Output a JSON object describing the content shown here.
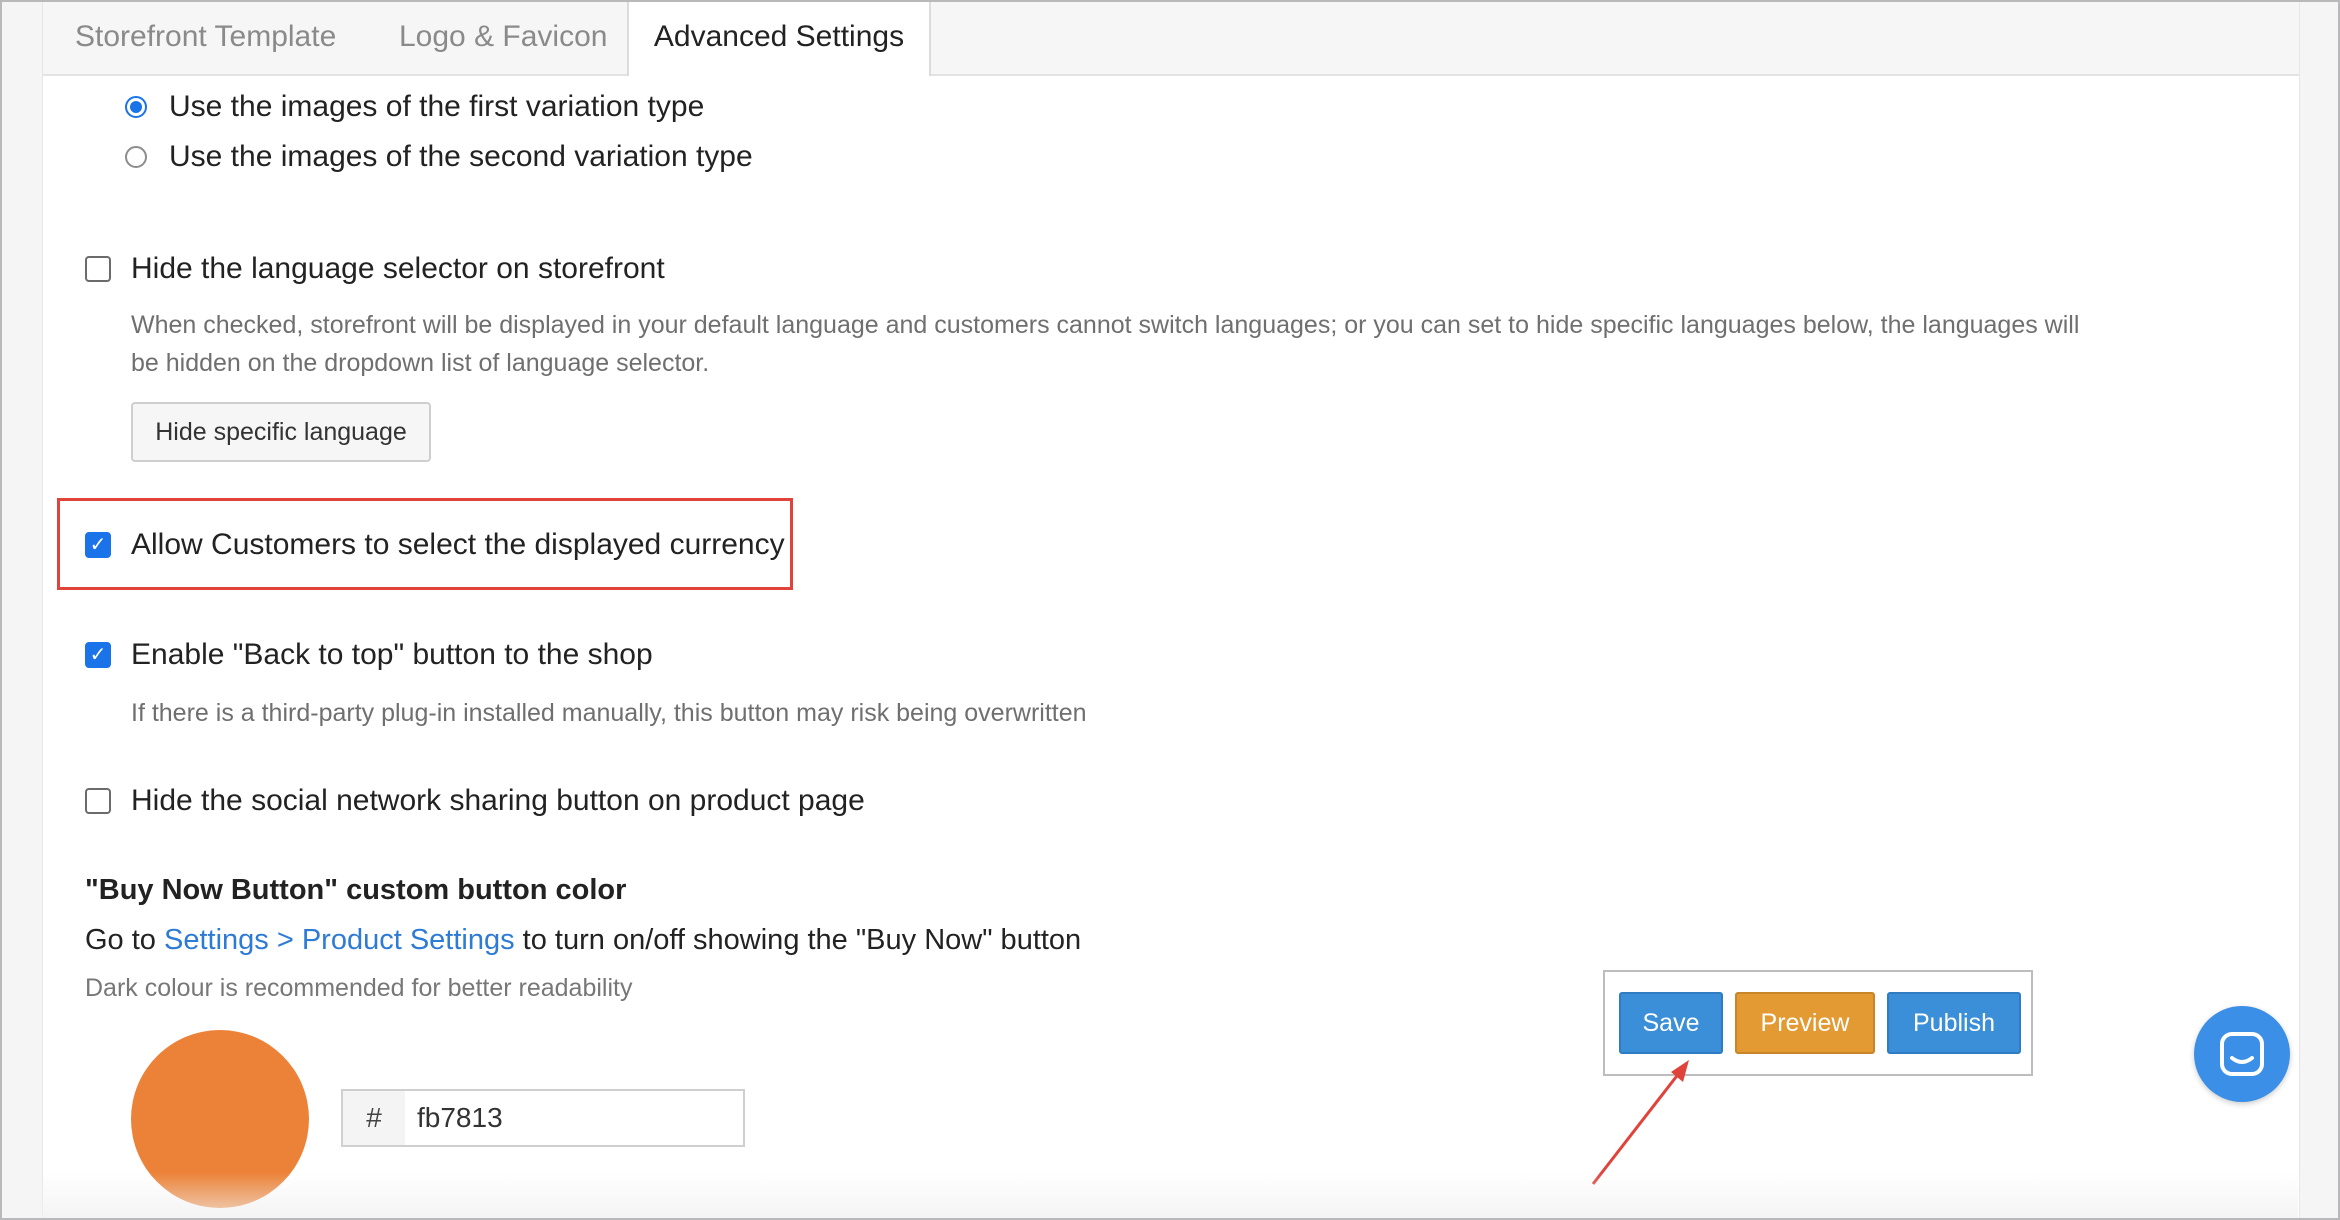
{
  "tabs": [
    {
      "label": "Storefront Template"
    },
    {
      "label": "Logo & Favicon"
    },
    {
      "label": "Advanced Settings"
    }
  ],
  "variation": {
    "option1": "Use the images of the first variation type",
    "option2": "Use the images of the second variation type"
  },
  "language": {
    "label": "Hide the language selector on storefront",
    "help_line1": "When checked, storefront will be displayed in your default language and customers cannot switch languages; or you can set to hide specific languages below, the languages will",
    "help_line2": "be hidden on the dropdown list of language selector.",
    "button": "Hide specific language"
  },
  "currency": {
    "label": "Allow Customers to select the displayed currency"
  },
  "back_to_top": {
    "label": "Enable \"Back to top\" button to the shop",
    "help": "If there is a third-party plug-in installed manually, this button may risk being overwritten"
  },
  "social": {
    "label": "Hide the social network sharing button on product page"
  },
  "buy_now": {
    "title": "\"Buy Now Button\" custom button color",
    "goto_prefix": "Go to ",
    "goto_link": "Settings > Product Settings",
    "goto_suffix": " to turn on/off showing the \"Buy Now\" button",
    "note": "Dark colour is recommended for better readability",
    "hash": "#",
    "hex_value": "fb7813",
    "swatch_color": "#ec8237"
  },
  "actions": {
    "save": "Save",
    "preview": "Preview",
    "publish": "Publish"
  },
  "colors": {
    "accent": "#1a73e8",
    "highlight": "#e0433a",
    "save": "#3a8fd8",
    "preview": "#e39a33"
  }
}
